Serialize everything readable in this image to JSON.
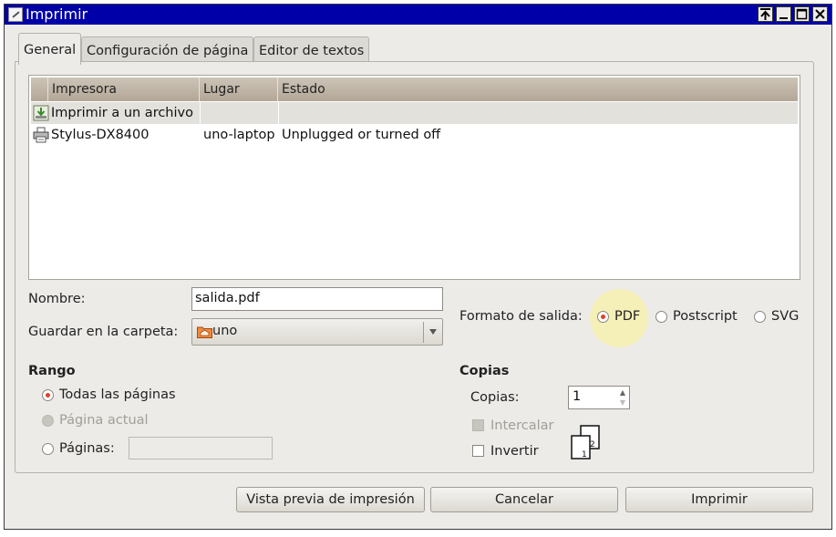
{
  "window": {
    "title": "Imprimir",
    "controls": [
      "keep-above",
      "minimize",
      "maximize",
      "close"
    ]
  },
  "tabs": [
    {
      "label": "General",
      "active": true
    },
    {
      "label": "Configuración de página",
      "active": false
    },
    {
      "label": "Editor de textos",
      "active": false
    }
  ],
  "printer_list": {
    "columns": [
      "Impresora",
      "Lugar",
      "Estado"
    ],
    "rows": [
      {
        "icon": "file-save-icon",
        "name": "Imprimir a un archivo",
        "location": "",
        "status": "",
        "selected": true
      },
      {
        "icon": "printer-icon",
        "name": "Stylus-DX8400",
        "location": "uno-laptop",
        "status": "Unplugged or turned off",
        "selected": false
      }
    ]
  },
  "form": {
    "name_label": "Nombre:",
    "name_value": "salida.pdf",
    "folder_label": "Guardar en la carpeta:",
    "folder_value": "uno",
    "output_format_label": "Formato de salida:",
    "output_formats": [
      {
        "label": "PDF",
        "selected": true
      },
      {
        "label": "Postscript",
        "selected": false
      },
      {
        "label": "SVG",
        "selected": false
      }
    ]
  },
  "range": {
    "heading": "Rango",
    "options": [
      {
        "label": "Todas las páginas",
        "selected": true,
        "enabled": true
      },
      {
        "label": "Página actual",
        "selected": false,
        "enabled": false
      },
      {
        "label": "Páginas:",
        "selected": false,
        "enabled": true
      }
    ],
    "pages_value": ""
  },
  "copies": {
    "heading": "Copias",
    "copies_label": "Copias:",
    "copies_value": "1",
    "collate_label": "Intercalar",
    "collate_enabled": false,
    "reverse_label": "Invertir",
    "reverse_checked": false,
    "collate_pages": [
      "1",
      "2"
    ]
  },
  "buttons": {
    "preview": "Vista previa de impresión",
    "cancel": "Cancelar",
    "print": "Imprimir"
  },
  "colors": {
    "titlebar": "#0000a8",
    "radio_selected": "#e0402a",
    "highlight": "#f6f0b3"
  }
}
